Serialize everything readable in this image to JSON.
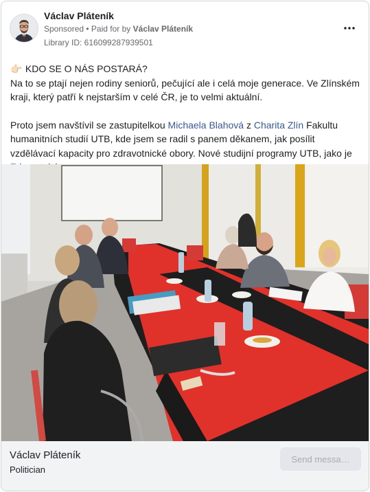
{
  "post": {
    "author": "Václav Pláteník",
    "sponsored": "Sponsored",
    "paid_prefix": "• Paid for by",
    "paid_by": "Václav Pláteník",
    "library_id": "Library ID: 616099287939501",
    "menu_icon": "more-dots-icon"
  },
  "text": {
    "emoji": "👉🏻",
    "line1": "KDO SE O NÁS POSTARÁ?",
    "para1": "Na to se ptají nejen rodiny seniorů, pečující ale i celá moje generace. Ve Zlínském kraji, který patří k nejstarším v celé ČR, je to velmi aktuální.",
    "para2_a": "Proto jsem navštívil se zastupitelkou ",
    "link1": "Michaela Blahová",
    "para2_b": " z ",
    "link2": "Charita Zlín",
    "para2_c": " Fakultu humanitních studií UTB, kde jsem se radil s panem děkanem, jak posílit vzdělávací kapacity pro zdravotnické obory. Nové studijní programy UTB, jako je Zdravotnick…"
  },
  "footer": {
    "name": "Václav Pláteník",
    "subtitle": "Politician",
    "send_button": "Send messa…"
  },
  "colors": {
    "link": "#385898",
    "table_red": "#e0312b",
    "footer_bg": "#f2f3f5"
  }
}
